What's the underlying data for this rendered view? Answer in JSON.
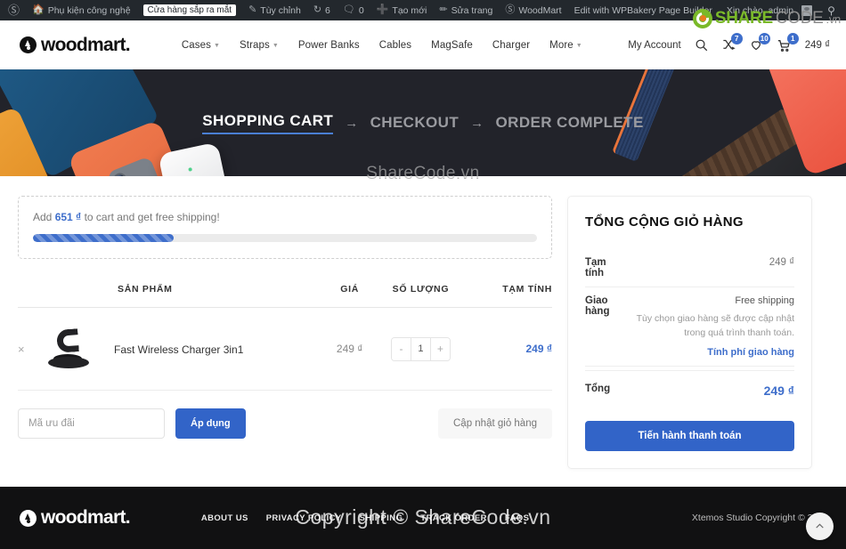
{
  "adminbar": {
    "wp_icon": "wordpress-icon",
    "site_name": "Phụ kiện công nghệ",
    "store_badge": "Cửa hàng sắp ra mắt",
    "customize": "Tùy chỉnh",
    "updates_count": "6",
    "comments_count": "0",
    "new": "Tạo mới",
    "edit_page": "Sửa trang",
    "woodmart": "WoodMart",
    "wpbakery": "Edit with WPBakery Page Builder",
    "greeting": "Xin chào, admin"
  },
  "watermark": {
    "logo_share": "SHARE",
    "logo_code": "CODE",
    "logo_tld": ".vn",
    "banner_text": "ShareCode.vn",
    "footer_text": "Copyright © ShareCode.vn"
  },
  "header": {
    "brand": "woodmart.",
    "nav": [
      {
        "label": "Cases",
        "has_caret": true
      },
      {
        "label": "Straps",
        "has_caret": true
      },
      {
        "label": "Power Banks",
        "has_caret": false
      },
      {
        "label": "Cables",
        "has_caret": false
      },
      {
        "label": "MagSafe",
        "has_caret": false
      },
      {
        "label": "Charger",
        "has_caret": false
      },
      {
        "label": "More",
        "has_caret": true
      }
    ],
    "my_account": "My Account",
    "search_icon": "search-icon",
    "compare_count": "7",
    "wishlist_count": "10",
    "cart_count": "1",
    "cart_total": "249 ₫"
  },
  "breadcrumb": {
    "step1": "SHOPPING CART",
    "arrow": "→",
    "step2": "CHECKOUT",
    "step3": "ORDER COMPLETE"
  },
  "free_shipping": {
    "prefix": "Add",
    "amount": "651 ₫",
    "suffix": "to cart and get free shipping!",
    "progress_percent": 28
  },
  "cart_table": {
    "headers": {
      "product": "SẢN PHẨM",
      "price": "GIÁ",
      "quantity": "SỐ LƯỢNG",
      "subtotal": "TẠM TÍNH"
    },
    "rows": [
      {
        "remove": "×",
        "name": "Fast Wireless Charger 3in1",
        "price": "249 ₫",
        "qty_minus": "-",
        "qty": "1",
        "qty_plus": "+",
        "subtotal": "249 ₫"
      }
    ]
  },
  "cart_actions": {
    "coupon_placeholder": "Mã ưu đãi",
    "coupon_value": "",
    "apply": "Áp dụng",
    "update": "Cập nhật giỏ hàng"
  },
  "totals": {
    "title": "TỔNG CỘNG GIỎ HÀNG",
    "subtotal_label": "Tạm tính",
    "subtotal_value": "249 ₫",
    "shipping_label": "Giao hàng",
    "shipping_method": "Free shipping",
    "shipping_note": "Tùy chọn giao hàng sẽ được cập nhật trong quá trình thanh toán.",
    "shipping_link": "Tính phí giao hàng",
    "total_label": "Tổng",
    "total_value": "249 ₫",
    "checkout": "Tiến hành thanh toán"
  },
  "footer": {
    "brand": "woodmart.",
    "menu": [
      "ABOUT US",
      "PRIVACY POLICY",
      "SHIPPING",
      "TRACK ORDER",
      "FAQS"
    ],
    "copyright": "Xtemos Studio Copyright © 2022",
    "scroll_top_icon": "chevron-up-icon"
  }
}
